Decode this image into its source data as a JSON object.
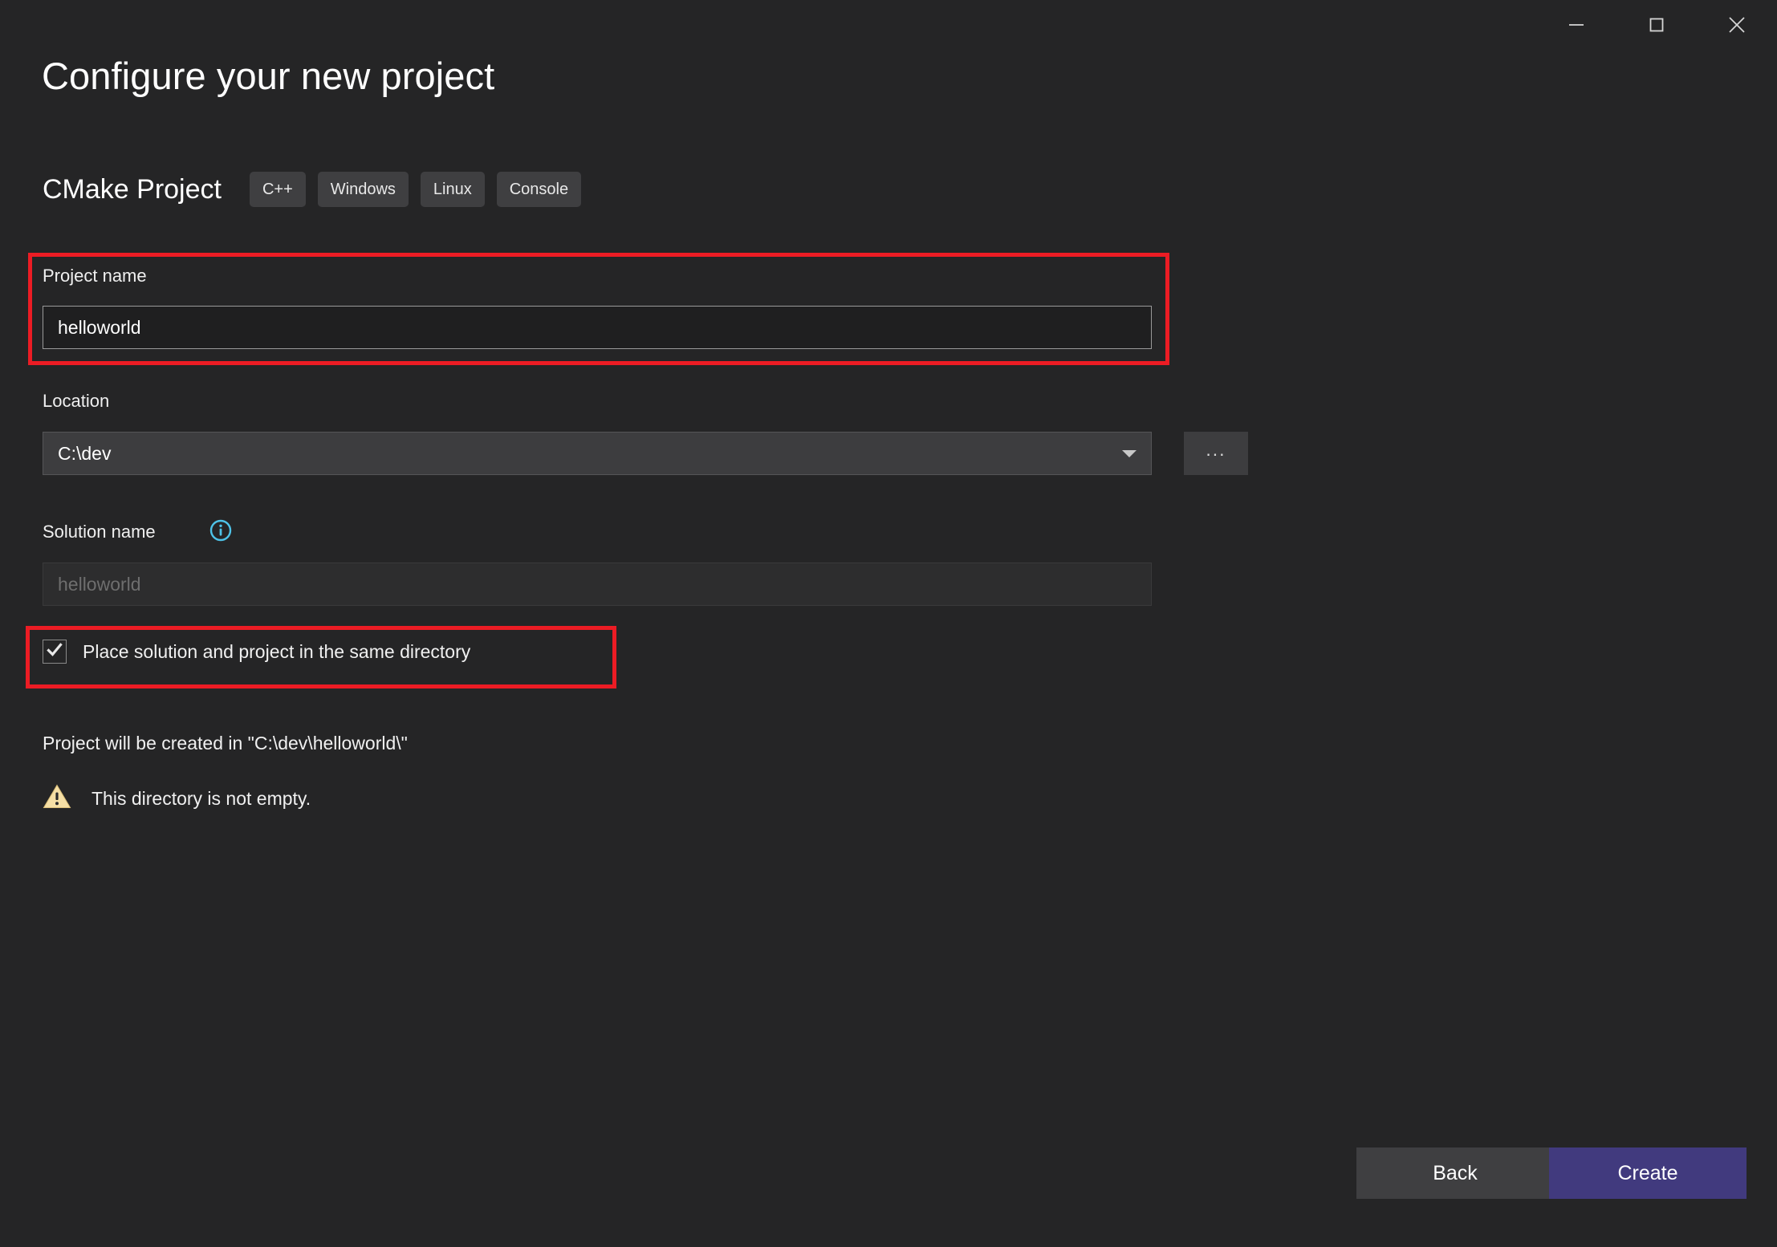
{
  "window": {
    "controls": [
      {
        "name": "minimize",
        "glyph": "minimize-icon",
        "label": "Minimize"
      },
      {
        "name": "maximize",
        "glyph": "maximize-icon",
        "label": "Maximize"
      },
      {
        "name": "close",
        "glyph": "close-icon",
        "label": "Close"
      }
    ]
  },
  "header": {
    "title": "Configure your new project",
    "template_name": "CMake Project",
    "tags": [
      "C++",
      "Windows",
      "Linux",
      "Console"
    ]
  },
  "form": {
    "project_name": {
      "label": "Project name",
      "value": "helloworld",
      "placeholder": ""
    },
    "location": {
      "label": "Location",
      "value": "C:\\dev",
      "browse_label": "...",
      "dropdown_icon": "chevron-down-icon"
    },
    "solution_name": {
      "label": "Solution name",
      "info_icon": "info-circle-icon",
      "value": "",
      "placeholder": "helloworld",
      "disabled": true
    },
    "same_directory_checkbox": {
      "label": "Place solution and project in the same directory",
      "checked": true,
      "check_icon": "checkmark-icon"
    },
    "created_in_text": "Project will be created in \"C:\\dev\\helloworld\\\"",
    "warning": {
      "icon": "warning-triangle-icon",
      "text": "This directory is not empty."
    }
  },
  "footer": {
    "back_label": "Back",
    "create_label": "Create"
  },
  "annotations": {
    "highlight_color": "#ec1c24",
    "boxes": [
      "project-name-highlight",
      "same-directory-highlight"
    ]
  },
  "colors": {
    "background": "#252526",
    "accent_primary": "#413a7e",
    "info": "#4ec3e8",
    "warning": "#f5dfa5",
    "highlight": "#ec1c24"
  }
}
